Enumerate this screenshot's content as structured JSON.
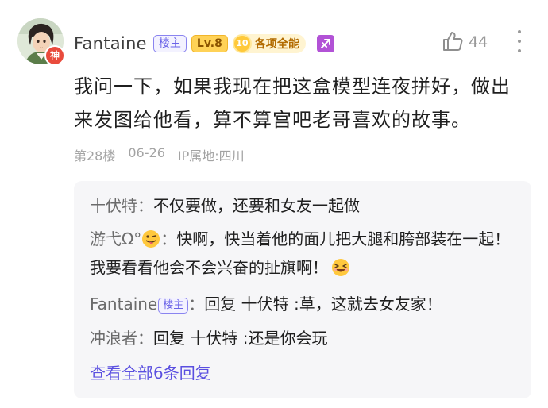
{
  "post": {
    "author": {
      "name": "Fantaine",
      "avatar_badge": "神",
      "owner_tag": "楼主",
      "level_tag": "Lv.8",
      "award_number": "10",
      "award_label": "各项全能",
      "zodiac_icon": "sagittarius-icon"
    },
    "likes": "44",
    "content": "我问一下，如果我现在把这盒模型连夜拼好，做出来发图给他看，算不算宫吧老哥喜欢的故事。",
    "floor": "第28楼",
    "date": "06-26",
    "ip_location": "IP属地:四川"
  },
  "replies": {
    "items": [
      {
        "name": "十伏特",
        "separator": "：",
        "text": "不仅要做，还要和女友一起做"
      },
      {
        "name": "游弋Ω°",
        "separator": "：",
        "text_a": "快啊，快当着他的面儿把大腿和胯部装在一起！我要看看他会不会兴奋的扯旗啊！"
      },
      {
        "name": "Fantaine",
        "owner_tag": "楼主",
        "separator": "：",
        "text": "回复 十伏特 :草，这就去女友家！"
      },
      {
        "name": "冲浪者",
        "separator": "：",
        "text": "回复 十伏特 :还是你会玩"
      }
    ],
    "view_all": "查看全部6条回复"
  },
  "colors": {
    "accent": "#5a4fe0",
    "owner_tag": "#6a63e8",
    "level_bg": "#ffd257",
    "zodiac_bg": "#b252d6",
    "avatar_badge": "#e94b3c",
    "reply_bg": "#f6f6f8"
  }
}
